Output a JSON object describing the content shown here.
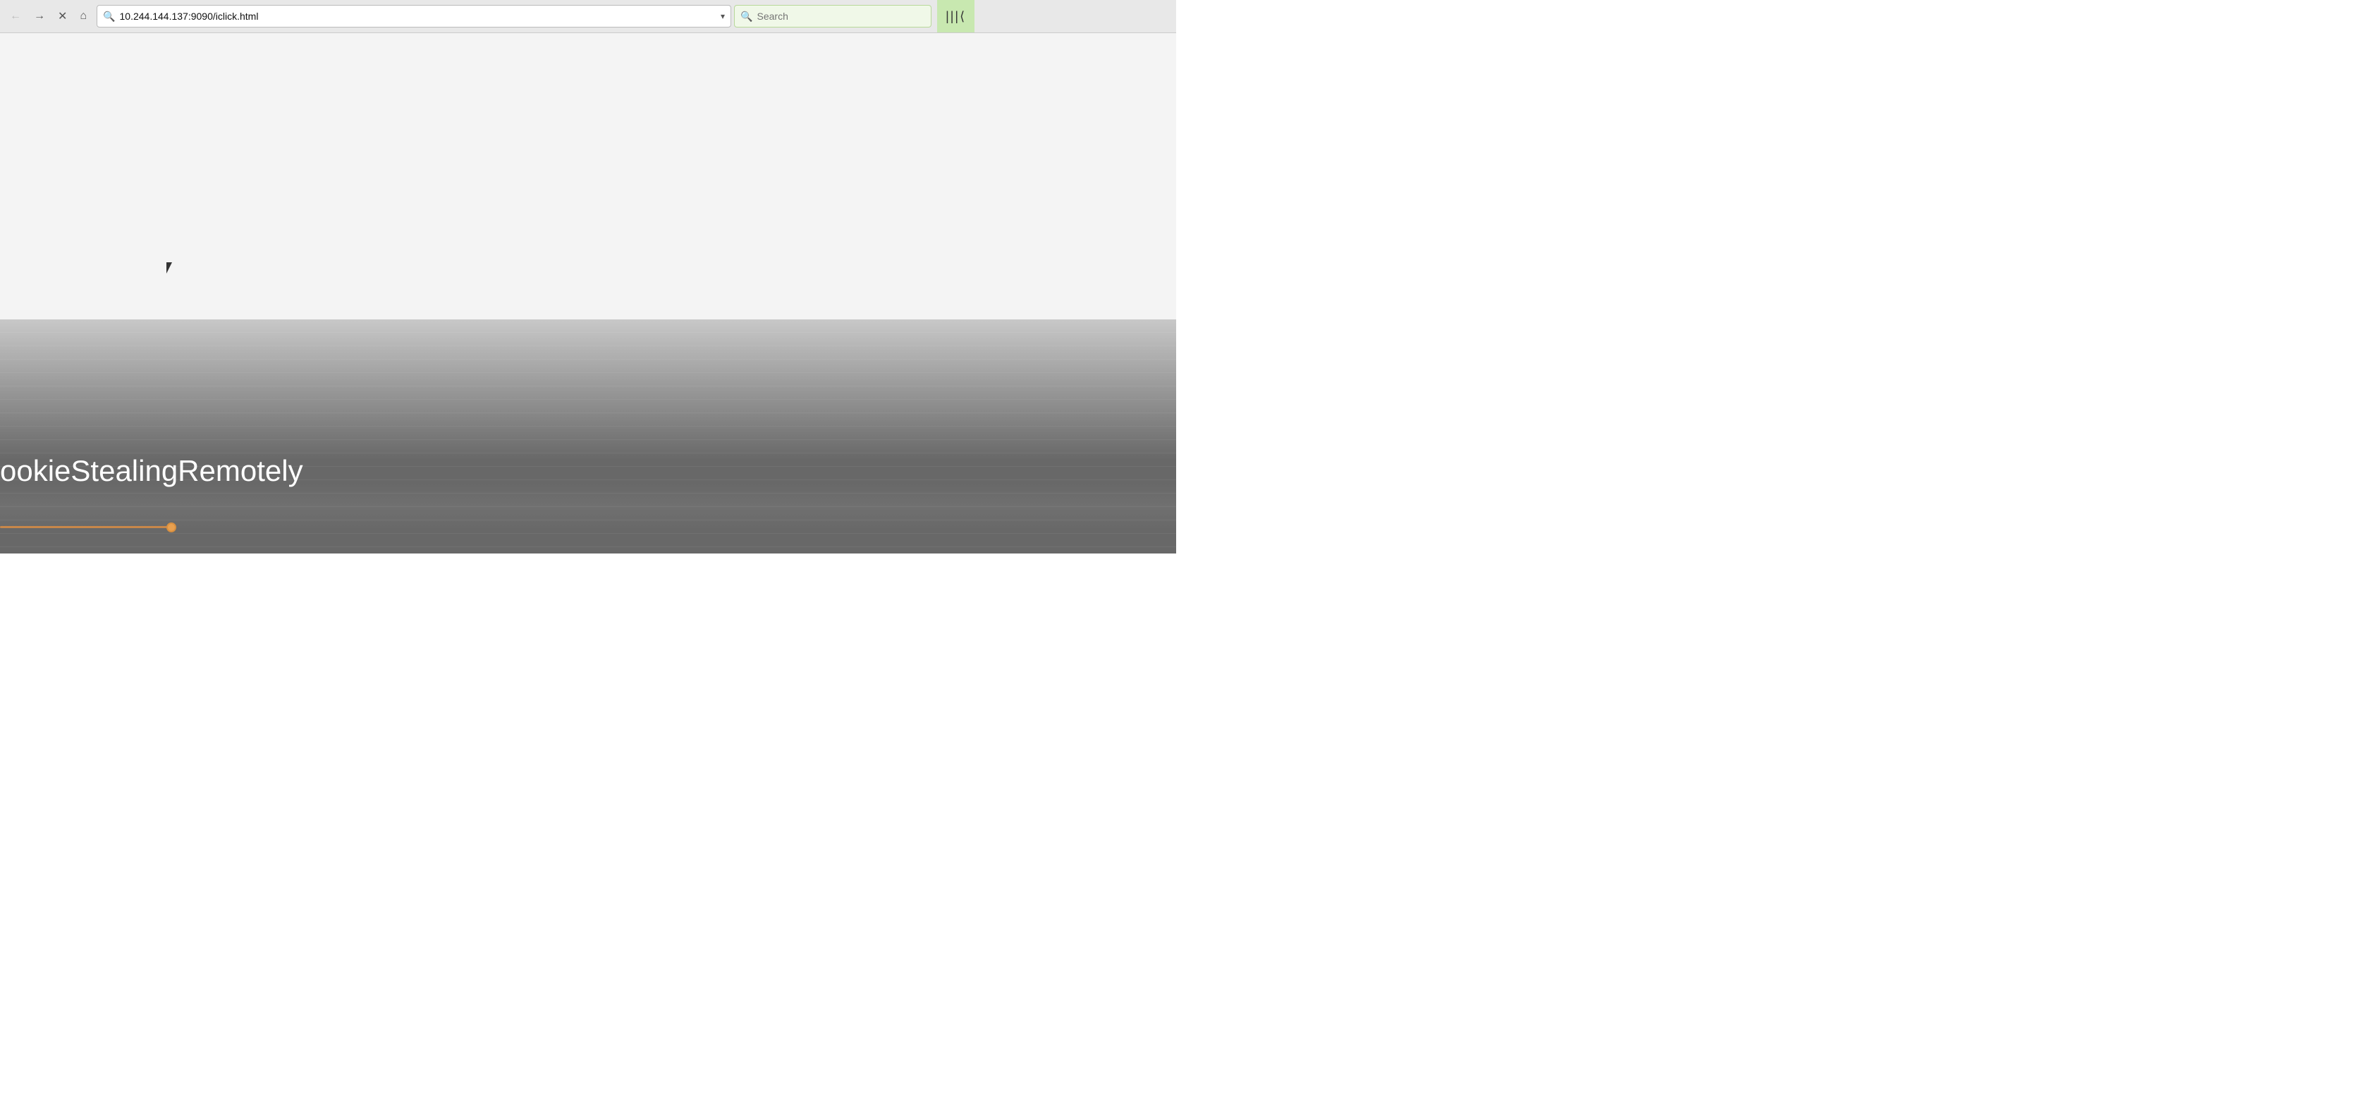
{
  "toolbar": {
    "back_label": "←",
    "forward_label": "→",
    "stop_label": "✕",
    "home_label": "⌂",
    "url": "10.244.144.137:9090/iclick.html",
    "url_placeholder": "10.244.144.137:9090/iclick.html",
    "dropdown_label": "▾",
    "search_placeholder": "Search",
    "bookmarks_label": "|||⟨"
  },
  "page": {
    "cookie_text": "ookieStealingRemotely",
    "progress_value": "25"
  }
}
